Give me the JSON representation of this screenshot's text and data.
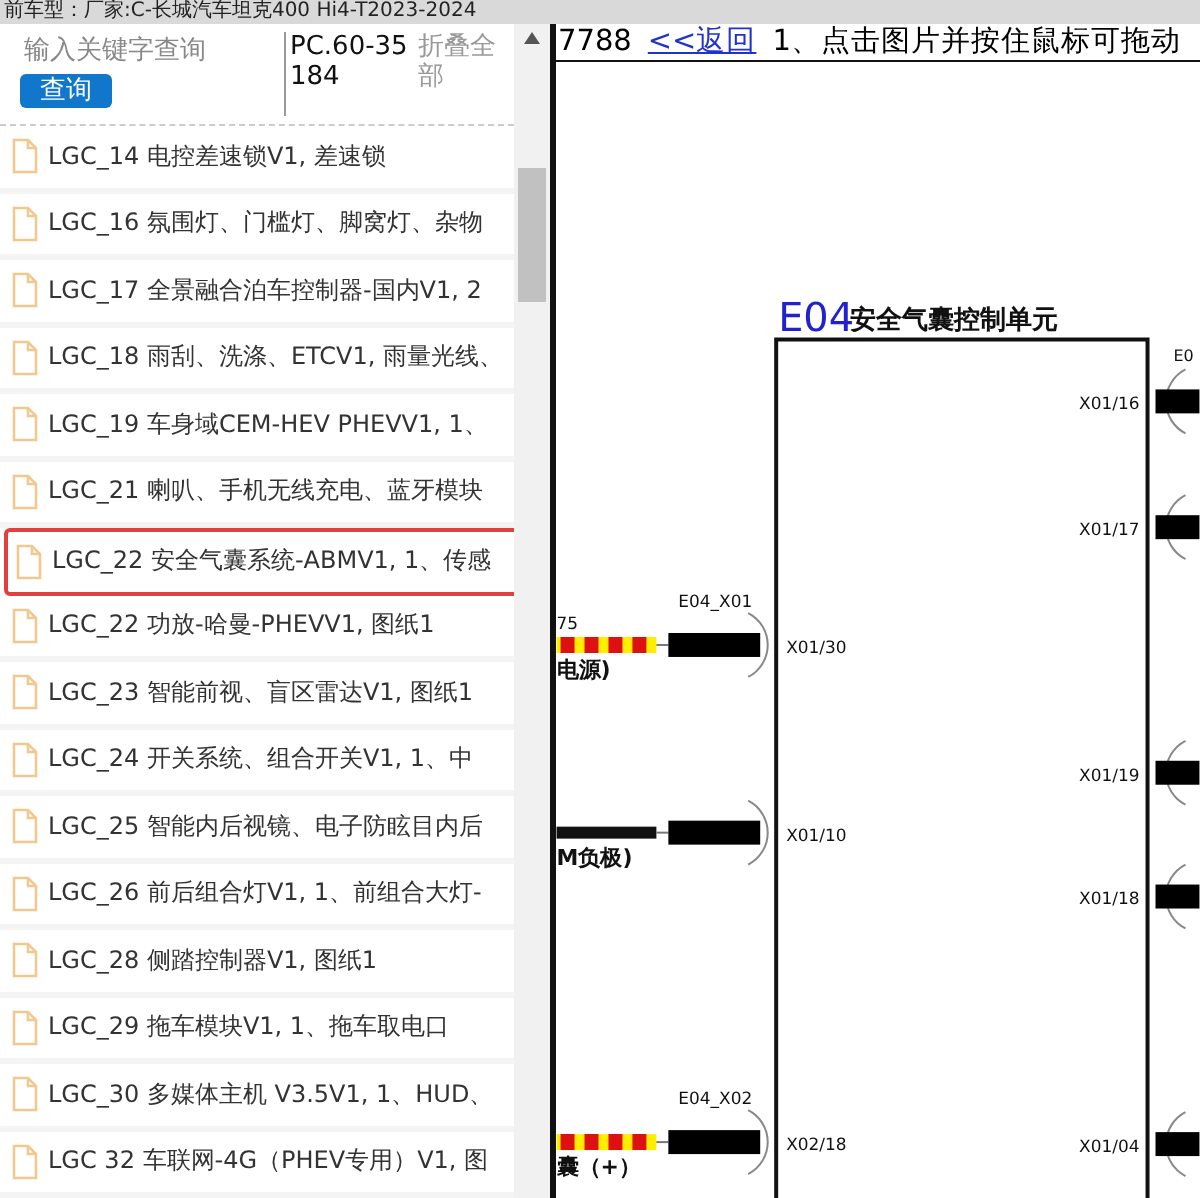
{
  "top_bar": {
    "text": "前车型：厂家:C-长城汽车坦克400 Hi4-T2023-2024"
  },
  "sidebar": {
    "search": {
      "placeholder": "输入关键字查询"
    },
    "search_button": "查询",
    "code": "PC.60-35184",
    "collapse_all": "折叠全部",
    "items": [
      {
        "label": "LGC_14 电控差速锁V1, 差速锁",
        "selected": false
      },
      {
        "label": "LGC_16 氛围灯、门槛灯、脚窝灯、杂物",
        "selected": false
      },
      {
        "label": "LGC_17 全景融合泊车控制器-国内V1, 2",
        "selected": false
      },
      {
        "label": "LGC_18 雨刮、洗涤、ETCV1, 雨量光线、",
        "selected": false
      },
      {
        "label": "LGC_19 车身域CEM-HEV PHEVV1, 1、",
        "selected": false
      },
      {
        "label": "LGC_21 喇叭、手机无线充电、蓝牙模块",
        "selected": false
      },
      {
        "label": "LGC_22 安全气囊系统-ABMV1, 1、传感",
        "selected": true
      },
      {
        "label": "LGC_22 功放-哈曼-PHEVV1, 图纸1",
        "selected": false
      },
      {
        "label": "LGC_23 智能前视、盲区雷达V1, 图纸1",
        "selected": false
      },
      {
        "label": "LGC_24 开关系统、组合开关V1, 1、中",
        "selected": false
      },
      {
        "label": "LGC_25 智能内后视镜、电子防眩目内后",
        "selected": false
      },
      {
        "label": "LGC_26 前后组合灯V1, 1、前组合大灯-",
        "selected": false
      },
      {
        "label": "LGC_28 侧踏控制器V1, 图纸1",
        "selected": false
      },
      {
        "label": "LGC_29 拖车模块V1, 1、拖车取电口",
        "selected": false
      },
      {
        "label": "LGC_30 多媒体主机 V3.5V1, 1、HUD、",
        "selected": false
      },
      {
        "label": "LGC 32 车联网-4G（PHEV专用）V1, 图",
        "selected": false
      }
    ]
  },
  "viewer": {
    "id_text": "7788",
    "back_link": "<<返回",
    "hint": "1、点击图片并按住鼠标可拖动",
    "diagram": {
      "title_code": "E04",
      "title": "安全气囊控制单元",
      "right_connector": "E0",
      "left_connectors": [
        {
          "connector": "E04_X01",
          "pin": "X01/30",
          "wire_number": "75",
          "wire_label": "电源)",
          "kind": "striped"
        },
        {
          "pin": "X01/10",
          "wire_label": "M负极)",
          "kind": "solid"
        },
        {
          "connector": "E04_X02",
          "pin": "X02/18",
          "wire_label": "囊（+）",
          "kind": "striped"
        }
      ],
      "right_pins": [
        "X01/16",
        "X01/17",
        "X01/19",
        "X01/18",
        "X01/04"
      ]
    }
  }
}
